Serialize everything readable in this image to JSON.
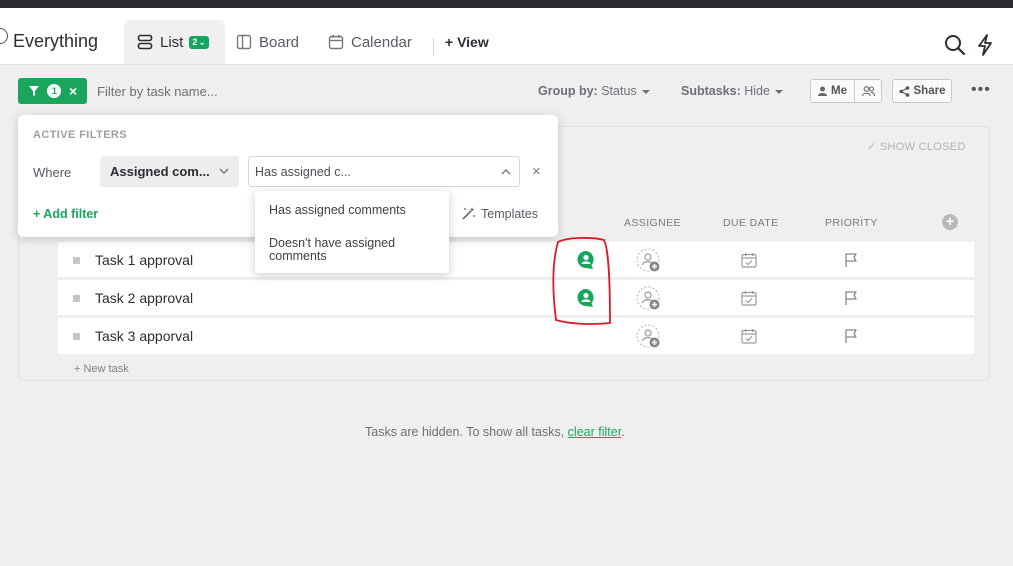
{
  "header": {
    "space_title": "Everything",
    "tabs": [
      {
        "label": "List",
        "badge": "2"
      },
      {
        "label": "Board"
      },
      {
        "label": "Calendar"
      }
    ],
    "add_view": "+ View"
  },
  "toolbar": {
    "filter_count": "1",
    "filter_clear": "×",
    "search_placeholder": "Filter by task name...",
    "group_by_label": "Group by:",
    "group_by_value": "Status",
    "subtasks_label": "Subtasks:",
    "subtasks_value": "Hide",
    "me_label": "Me",
    "share_label": "Share",
    "more": "•••"
  },
  "filter_panel": {
    "title": "ACTIVE FILTERS",
    "where": "Where",
    "field": "Assigned com...",
    "value": "Has assigned c...",
    "close": "×",
    "add_filter": "+ Add filter",
    "templates": "Templates"
  },
  "dropdown": {
    "options": [
      "Has assigned comments",
      "Doesn't have assigned comments"
    ]
  },
  "list": {
    "show_closed": "✓ SHOW CLOSED",
    "columns": [
      "ASSIGNEE",
      "DUE DATE",
      "PRIORITY"
    ],
    "tasks": [
      {
        "name": "Task 1 approval",
        "has_comment": true
      },
      {
        "name": "Task 2 approval",
        "has_comment": true
      },
      {
        "name": "Task 3 apporval",
        "has_comment": false
      }
    ],
    "new_task": "+ New task"
  },
  "footer": {
    "hidden_text": "Tasks are hidden. To show all tasks,",
    "clear_link": "clear filter",
    "period": "."
  },
  "colors": {
    "accent": "#1aa55c",
    "annotation": "#e0182b"
  }
}
